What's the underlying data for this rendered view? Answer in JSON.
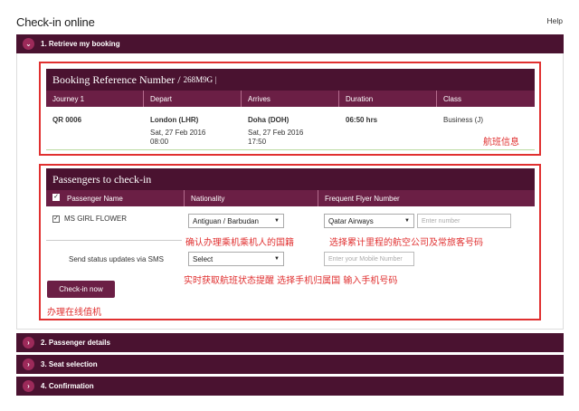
{
  "header": {
    "title": "Check-in online",
    "help_label": "Help"
  },
  "steps": [
    {
      "label": "1. Retrieve my booking",
      "icon": "chevron-down-icon"
    },
    {
      "label": "2. Passenger details",
      "icon": "chevron-right-icon"
    },
    {
      "label": "3. Seat selection",
      "icon": "chevron-right-icon"
    },
    {
      "label": "4. Confirmation",
      "icon": "chevron-right-icon"
    }
  ],
  "booking": {
    "title": "Booking Reference Number /",
    "reference": "268M9G |",
    "columns": [
      "Journey 1",
      "Depart",
      "Arrives",
      "Duration",
      "Class"
    ],
    "flight": "QR 0006",
    "depart_city": "London (LHR)",
    "depart_date": "Sat, 27 Feb 2016",
    "depart_time": "08:00",
    "arrive_city": "Doha (DOH)",
    "arrive_date": "Sat, 27 Feb 2016",
    "arrive_time": "17:50",
    "duration": "06:50 hrs",
    "class": "Business (J)"
  },
  "passengers": {
    "title": "Passengers to check-in",
    "columns": [
      "Passenger Name",
      "Nationality",
      "Frequent Flyer Number"
    ],
    "name": "MS GIRL  FLOWER",
    "nationality": "Antiguan / Barbudan",
    "airline": "Qatar Airways",
    "ff_placeholder": "Enter number",
    "sms_label": "Send status updates via SMS",
    "sms_select": "Select",
    "mobile_placeholder": "Enter your Mobile Number",
    "checkin_button": "Check-in now"
  },
  "annotations": {
    "flight_info": "航班信息",
    "nationality_note": "确认办理乘机乘机人的国籍",
    "ff_note": "选择累计里程的航空公司及常旅客号码",
    "sms_note": "实时获取航班状态提醒 选择手机归属国 输入手机号码",
    "checkin_note": "办理在线值机"
  },
  "colors": {
    "primary": "#4a1230",
    "secondary": "#6b1f45",
    "annotation": "#e03030"
  }
}
